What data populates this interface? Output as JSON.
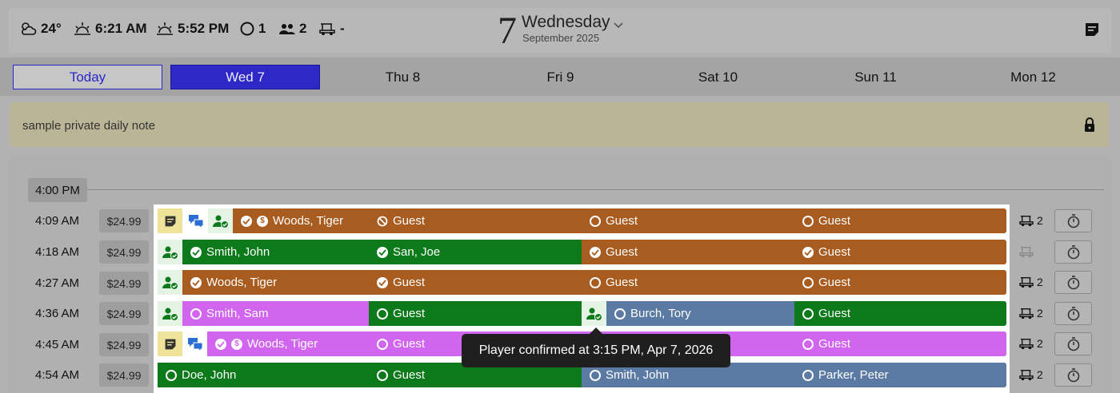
{
  "weather": {
    "temp": "24°",
    "sunrise": "6:21 AM",
    "sunset": "5:52 PM",
    "rounds": "1",
    "players": "2",
    "carts": "-"
  },
  "date": {
    "day_number": "7",
    "day_name": "Wednesday",
    "month_year": "September 2025"
  },
  "days": [
    "Today",
    "Wed 7",
    "Thu 8",
    "Fri 9",
    "Sat 10",
    "Sun 11",
    "Mon 12"
  ],
  "note": {
    "text": "sample private daily note"
  },
  "time_header": "4:00 PM",
  "tooltip": "Player confirmed at 3:15 PM, Apr 7, 2026",
  "colors": {
    "orange": "#a85c1f",
    "green": "#0c7a1b",
    "purple": "#d265ef",
    "blue": "#5a7aa4",
    "selected": "#2e29c6"
  },
  "rows": [
    {
      "time": "4:09 AM",
      "price": "$24.99",
      "cart": "2",
      "players": [
        "Woods, Tiger",
        "Guest",
        "Guest",
        "Guest"
      ]
    },
    {
      "time": "4:18 AM",
      "price": "$24.99",
      "cart": "",
      "players": [
        "Smith, John",
        "San, Joe",
        "Guest",
        "Guest"
      ]
    },
    {
      "time": "4:27 AM",
      "price": "$24.99",
      "cart": "2",
      "players": [
        "Woods, Tiger",
        "Guest",
        "Guest",
        "Guest"
      ]
    },
    {
      "time": "4:36 AM",
      "price": "$24.99",
      "cart": "2",
      "players": [
        "Smith, Sam",
        "Guest",
        "Burch, Tory",
        "Guest"
      ]
    },
    {
      "time": "4:45 AM",
      "price": "$24.99",
      "cart": "2",
      "players": [
        "Woods, Tiger",
        "Guest",
        "",
        "Guest"
      ]
    },
    {
      "time": "4:54 AM",
      "price": "$24.99",
      "cart": "2",
      "players": [
        "Doe, John",
        "Guest",
        "Smith, John",
        "Parker, Peter"
      ]
    }
  ]
}
